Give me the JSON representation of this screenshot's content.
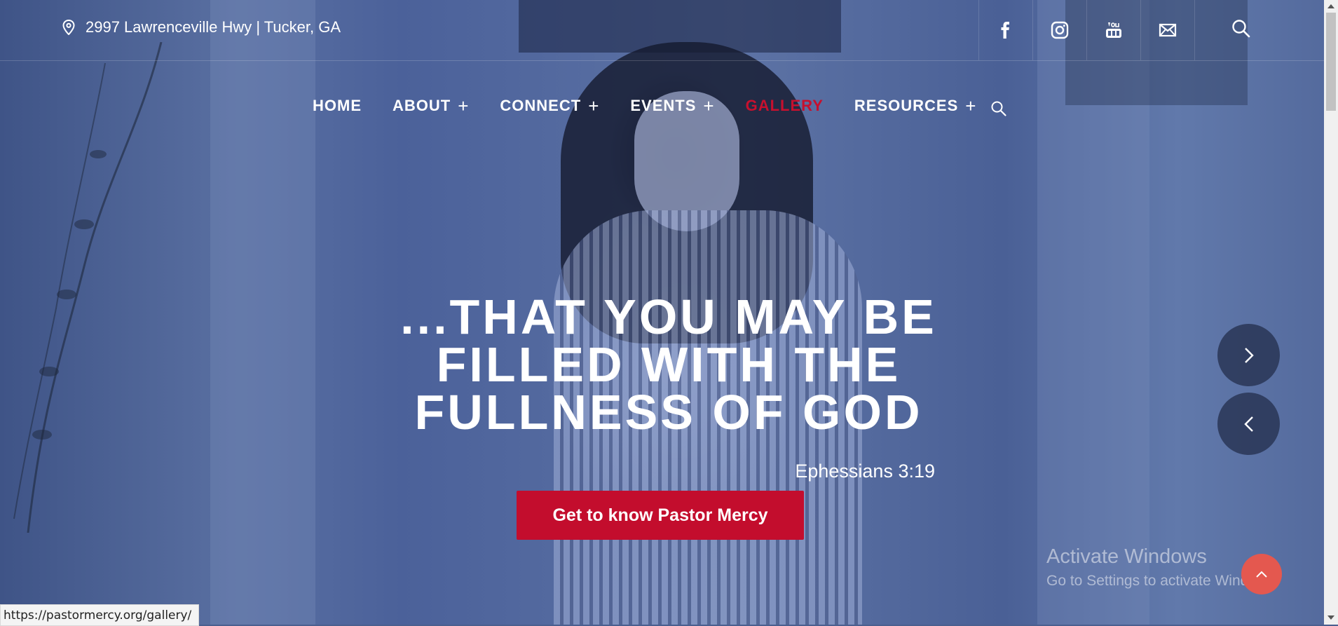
{
  "topbar": {
    "address": "2997 Lawrenceville Hwy | Tucker, GA",
    "icons": [
      "map-pin-icon",
      "facebook-icon",
      "instagram-icon",
      "youtube-icon",
      "mail-icon",
      "search-icon"
    ]
  },
  "nav": {
    "items": [
      {
        "label": "HOME",
        "has_submenu": false
      },
      {
        "label": "ABOUT",
        "has_submenu": true
      },
      {
        "label": "CONNECT",
        "has_submenu": true
      },
      {
        "label": "EVENTS",
        "has_submenu": true
      },
      {
        "label": "GALLERY",
        "has_submenu": false,
        "active": true
      },
      {
        "label": "RESOURCES",
        "has_submenu": true
      }
    ],
    "plus_symbol": "+",
    "active_color": "#c7102e"
  },
  "hero": {
    "headline_lines": [
      "...THAT YOU MAY BE",
      "FILLED WITH THE",
      "FULLNESS OF GOD"
    ],
    "verse": "Ephessians 3:19",
    "cta_label": "Get to know Pastor Mercy",
    "cta_color": "#c30d2d"
  },
  "slider": {
    "next_icon": "chevron-right-icon",
    "prev_icon": "chevron-left-icon"
  },
  "watermark": {
    "title": "Activate Windows",
    "subtitle": "Go to Settings to activate Windows."
  },
  "back_to_top": {
    "icon": "chevron-up-icon",
    "color": "#e4584f"
  },
  "status_bar": {
    "url": "https://pastormercy.org/gallery/"
  }
}
